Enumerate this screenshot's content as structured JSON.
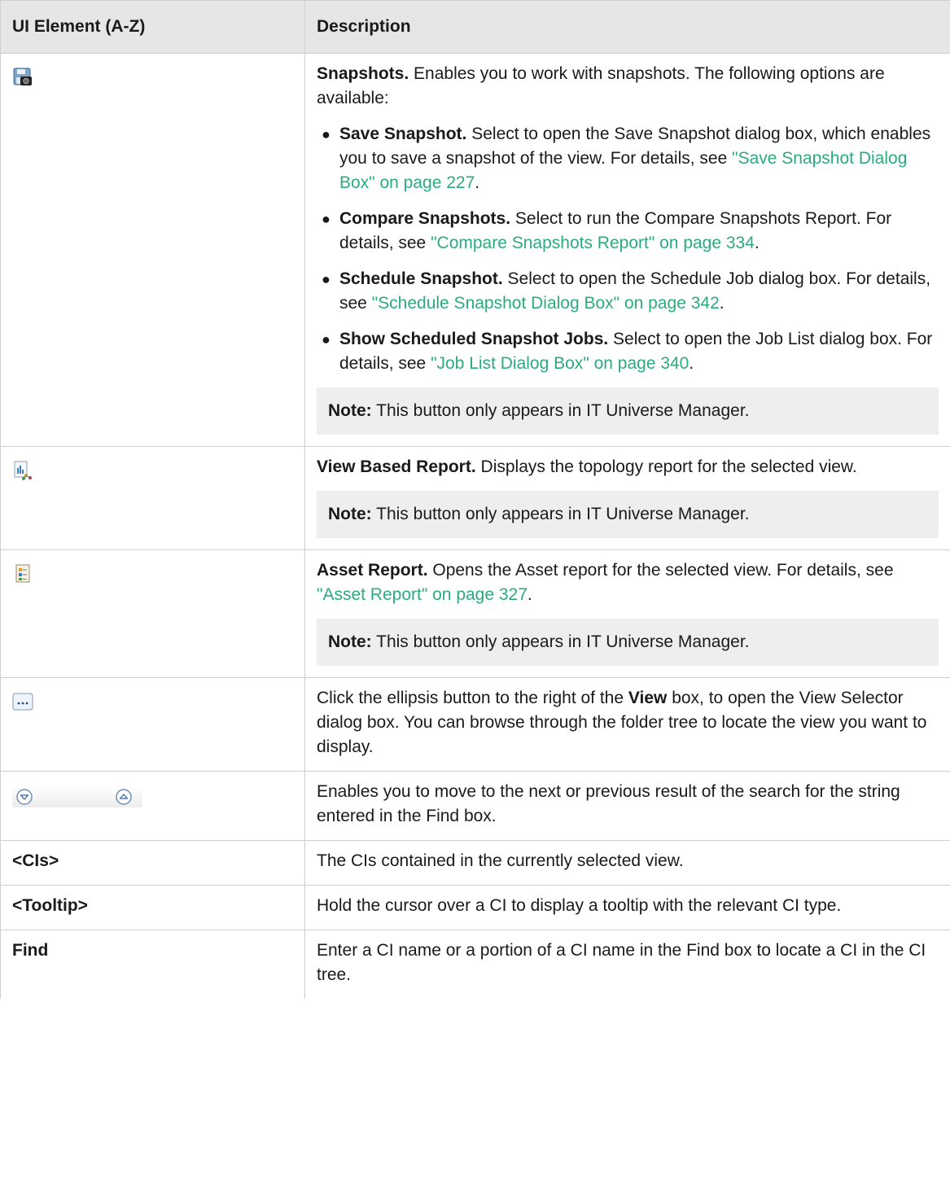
{
  "header": {
    "col1": "UI Element (A-Z)",
    "col2": "Description"
  },
  "rows": {
    "snapshots": {
      "icon": "snapshot-camera-icon",
      "title": "Snapshots.",
      "intro": " Enables you to work with snapshots. The following options are available:",
      "opts": [
        {
          "title": "Save Snapshot.",
          "text": " Select to open the Save Snapshot dialog box, which enables you to save a snapshot of the view. For details, see ",
          "link": "\"Save Snapshot Dialog Box\" on page 227",
          "end": "."
        },
        {
          "title": "Compare Snapshots.",
          "text": " Select to run the Compare Snapshots Report. For details, see ",
          "link": "\"Compare Snapshots Report\" on page 334",
          "end": "."
        },
        {
          "title": "Schedule Snapshot.",
          "text": " Select to open the Schedule Job dialog box. For details, see ",
          "link": "\"Schedule Snapshot Dialog Box\" on page 342",
          "end": "."
        },
        {
          "title": "Show Scheduled Snapshot Jobs.",
          "text": " Select to open the Job List dialog box. For details, see ",
          "link": "\"Job List Dialog Box\" on page 340",
          "end": "."
        }
      ],
      "note_label": "Note:",
      "note_text": " This button only appears in IT Universe Manager."
    },
    "viewreport": {
      "icon": "view-based-report-icon",
      "title": "View Based Report.",
      "text": " Displays the topology report for the selected view.",
      "note_label": "Note:",
      "note_text": " This button only appears in IT Universe Manager."
    },
    "asset": {
      "icon": "asset-report-icon",
      "title": "Asset Report.",
      "text": " Opens the Asset report for the selected view. For details, see ",
      "link": "\"Asset Report\" on page 327",
      "end": ".",
      "note_label": "Note:",
      "note_text": " This button only appears in IT Universe Manager."
    },
    "ellipsis": {
      "icon": "ellipsis-button-icon",
      "pre": "Click the ellipsis button to the right of the ",
      "bold": "View",
      "post": " box, to open the View Selector dialog box. You can browse through the folder tree to locate the view you want to display."
    },
    "nextprev": {
      "icon_next": "next-result-icon",
      "icon_prev": "previous-result-icon",
      "text": "Enables you to move to the next or previous result of the search for the string entered in the Find box."
    },
    "cis": {
      "label": "<CIs>",
      "text": "The CIs contained in the currently selected view."
    },
    "tooltip": {
      "label": "<Tooltip>",
      "text": "Hold the cursor over a CI to display a tooltip with the relevant CI type."
    },
    "find": {
      "label": "Find",
      "text": "Enter a CI name or a portion of a CI name in the Find box to locate a CI in the CI tree."
    }
  },
  "colors": {
    "header_bg": "#e6e6e6",
    "link": "#2bab7e",
    "note_bg": "#eeeeee",
    "border": "#cfcfcf"
  }
}
